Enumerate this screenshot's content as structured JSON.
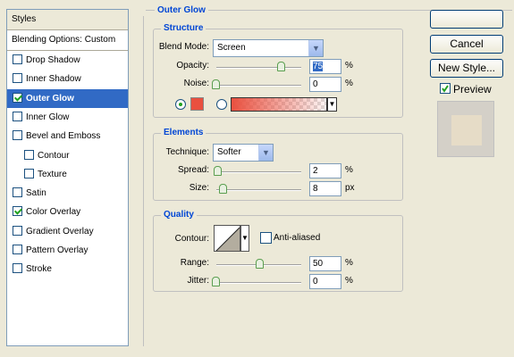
{
  "styles_panel": {
    "header": "Styles",
    "blending_options": "Blending Options: Custom",
    "items": [
      {
        "label": "Drop Shadow",
        "checked": false,
        "selected": false,
        "sub": false
      },
      {
        "label": "Inner Shadow",
        "checked": false,
        "selected": false,
        "sub": false
      },
      {
        "label": "Outer Glow",
        "checked": true,
        "selected": true,
        "sub": false
      },
      {
        "label": "Inner Glow",
        "checked": false,
        "selected": false,
        "sub": false
      },
      {
        "label": "Bevel and Emboss",
        "checked": false,
        "selected": false,
        "sub": false
      },
      {
        "label": "Contour",
        "checked": false,
        "selected": false,
        "sub": true
      },
      {
        "label": "Texture",
        "checked": false,
        "selected": false,
        "sub": true
      },
      {
        "label": "Satin",
        "checked": false,
        "selected": false,
        "sub": false
      },
      {
        "label": "Color Overlay",
        "checked": true,
        "selected": false,
        "sub": false
      },
      {
        "label": "Gradient Overlay",
        "checked": false,
        "selected": false,
        "sub": false
      },
      {
        "label": "Pattern Overlay",
        "checked": false,
        "selected": false,
        "sub": false
      },
      {
        "label": "Stroke",
        "checked": false,
        "selected": false,
        "sub": false
      }
    ]
  },
  "outer_glow": {
    "title": "Outer Glow",
    "structure": {
      "title": "Structure",
      "blend_mode_label": "Blend Mode:",
      "blend_mode_value": "Screen",
      "opacity_label": "Opacity:",
      "opacity_value": "75",
      "opacity_unit": "%",
      "noise_label": "Noise:",
      "noise_value": "0",
      "noise_unit": "%",
      "glow_color": "#e9503f"
    },
    "elements": {
      "title": "Elements",
      "technique_label": "Technique:",
      "technique_value": "Softer",
      "spread_label": "Spread:",
      "spread_value": "2",
      "spread_unit": "%",
      "size_label": "Size:",
      "size_value": "8",
      "size_unit": "px"
    },
    "quality": {
      "title": "Quality",
      "contour_label": "Contour:",
      "anti_aliased_label": "Anti-aliased",
      "range_label": "Range:",
      "range_value": "50",
      "range_unit": "%",
      "jitter_label": "Jitter:",
      "jitter_value": "0",
      "jitter_unit": "%"
    }
  },
  "buttons": {
    "ok": "",
    "cancel": "Cancel",
    "new_style": "New Style...",
    "preview": "Preview"
  },
  "colors": {
    "selection": "#316ac5",
    "group_title": "#0046d5",
    "glow": "#e9503f",
    "preview_swatch": "#e6dcc7"
  }
}
